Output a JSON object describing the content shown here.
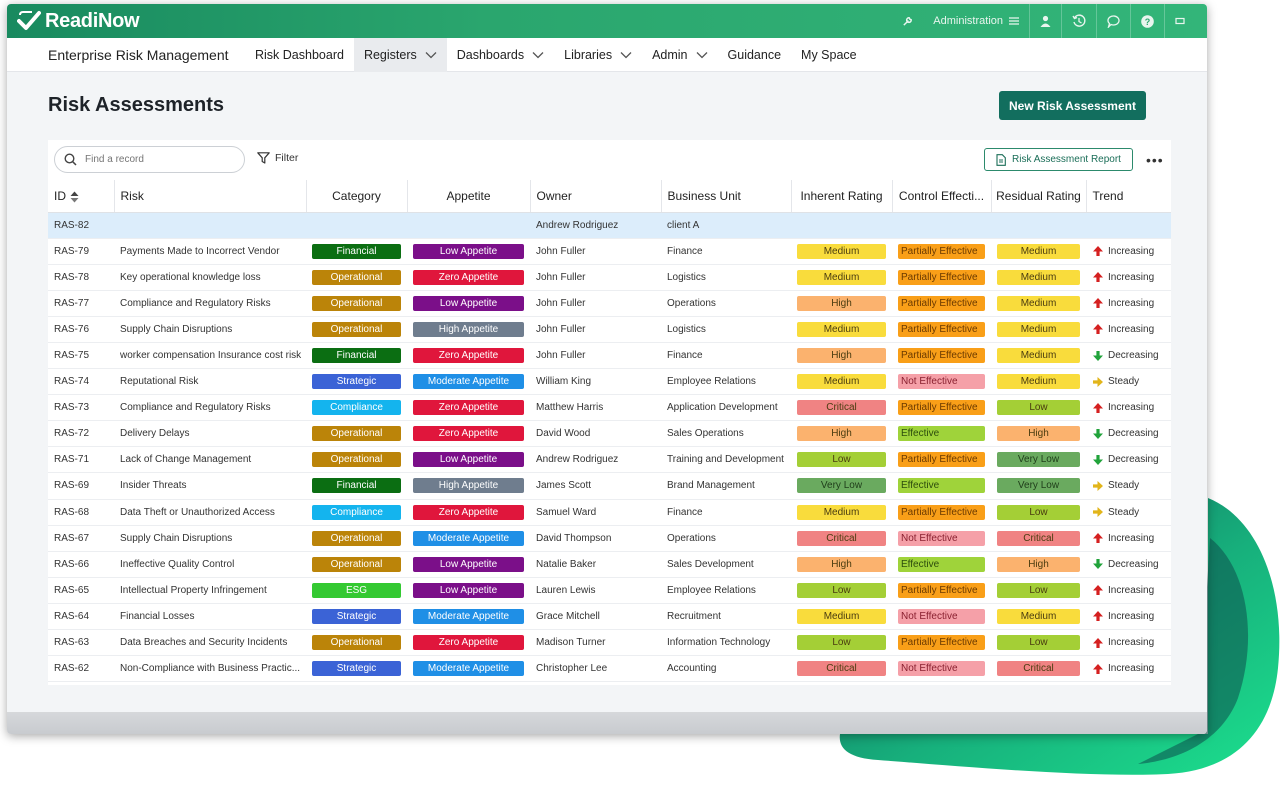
{
  "app": {
    "logo_text": "ReadiNow",
    "name": "Enterprise Risk Management"
  },
  "topbar": {
    "admin_label": "Administration"
  },
  "nav": [
    {
      "label": "Risk Dashboard",
      "dropdown": false
    },
    {
      "label": "Registers",
      "dropdown": true,
      "active": true
    },
    {
      "label": "Dashboards",
      "dropdown": true
    },
    {
      "label": "Libraries",
      "dropdown": true
    },
    {
      "label": "Admin",
      "dropdown": true
    },
    {
      "label": "Guidance",
      "dropdown": false
    },
    {
      "label": "My Space",
      "dropdown": false
    }
  ],
  "page": {
    "title": "Risk Assessments",
    "new_button": "New Risk Assessment"
  },
  "toolbar": {
    "search_placeholder": "Find a record",
    "filter_label": "Filter",
    "report_label": "Risk Assessment Report",
    "more_label": "•••"
  },
  "columns": [
    "ID",
    "Risk",
    "Category",
    "Appetite",
    "Owner",
    "Business Unit",
    "Inherent Rating",
    "Control Effecti...",
    "Residual Rating",
    "Trend"
  ],
  "colors": {
    "Financial": "#0b6e12",
    "Operational": "#bb8409",
    "Strategic": "#3b63d6",
    "Compliance": "#14b4ee",
    "ESG": "#34c932",
    "Low Appetite": "#7b0f89",
    "Zero Appetite": "#e0163c",
    "High Appetite": "#6f7d8e",
    "Moderate Appetite": "#1f8fe6",
    "Medium": "#f9dc3c",
    "High": "#fbb26e",
    "Critical": "#f08383",
    "Low": "#a4cf36",
    "Very Low": "#6aaa5f",
    "Partially Effective": "#f99f18",
    "Not Effective": "#f5a0a8",
    "Effective": "#9fd33a",
    "Increasing": "#d52020",
    "Decreasing": "#21a33b",
    "Steady": "#e2b51a"
  },
  "rows": [
    {
      "id": "RAS-82",
      "risk": "",
      "category": "",
      "appetite": "",
      "owner": "Andrew Rodriguez",
      "unit": "client A",
      "inherent": "",
      "control": "",
      "residual": "",
      "trend": "",
      "selected": true
    },
    {
      "id": "RAS-79",
      "risk": "Payments Made to Incorrect Vendor",
      "category": "Financial",
      "appetite": "Low Appetite",
      "owner": "John Fuller",
      "unit": "Finance",
      "inherent": "Medium",
      "control": "Partially Effective",
      "residual": "Medium",
      "trend": "Increasing"
    },
    {
      "id": "RAS-78",
      "risk": "Key operational knowledge loss",
      "category": "Operational",
      "appetite": "Zero Appetite",
      "owner": "John Fuller",
      "unit": "Logistics",
      "inherent": "Medium",
      "control": "Partially Effective",
      "residual": "Medium",
      "trend": "Increasing"
    },
    {
      "id": "RAS-77",
      "risk": "Compliance and Regulatory Risks",
      "category": "Operational",
      "appetite": "Low Appetite",
      "owner": "John Fuller",
      "unit": "Operations",
      "inherent": "High",
      "control": "Partially Effective",
      "residual": "Medium",
      "trend": "Increasing"
    },
    {
      "id": "RAS-76",
      "risk": "Supply Chain Disruptions",
      "category": "Operational",
      "appetite": "High Appetite",
      "owner": "John Fuller",
      "unit": "Logistics",
      "inherent": "Medium",
      "control": "Partially Effective",
      "residual": "Medium",
      "trend": "Increasing"
    },
    {
      "id": "RAS-75",
      "risk": "worker compensation Insurance cost risk",
      "category": "Financial",
      "appetite": "Zero Appetite",
      "owner": "John Fuller",
      "unit": "Finance",
      "inherent": "High",
      "control": "Partially Effective",
      "residual": "Medium",
      "trend": "Decreasing"
    },
    {
      "id": "RAS-74",
      "risk": "Reputational Risk",
      "category": "Strategic",
      "appetite": "Moderate Appetite",
      "owner": "William King",
      "unit": "Employee Relations",
      "inherent": "Medium",
      "control": "Not Effective",
      "residual": "Medium",
      "trend": "Steady"
    },
    {
      "id": "RAS-73",
      "risk": "Compliance and Regulatory Risks",
      "category": "Compliance",
      "appetite": "Zero Appetite",
      "owner": "Matthew Harris",
      "unit": "Application Development",
      "inherent": "Critical",
      "control": "Partially Effective",
      "residual": "Low",
      "trend": "Increasing"
    },
    {
      "id": "RAS-72",
      "risk": "Delivery Delays",
      "category": "Operational",
      "appetite": "Zero Appetite",
      "owner": "David Wood",
      "unit": "Sales Operations",
      "inherent": "High",
      "control": "Effective",
      "residual": "High",
      "trend": "Decreasing"
    },
    {
      "id": "RAS-71",
      "risk": "Lack of Change Management",
      "category": "Operational",
      "appetite": "Low Appetite",
      "owner": "Andrew Rodriguez",
      "unit": "Training and Development",
      "inherent": "Low",
      "control": "Partially Effective",
      "residual": "Very Low",
      "trend": "Decreasing"
    },
    {
      "id": "RAS-69",
      "risk": "Insider Threats",
      "category": "Financial",
      "appetite": "High Appetite",
      "owner": "James Scott",
      "unit": "Brand Management",
      "inherent": "Very Low",
      "control": "Effective",
      "residual": "Very Low",
      "trend": "Steady"
    },
    {
      "id": "RAS-68",
      "risk": "Data Theft or Unauthorized Access",
      "category": "Compliance",
      "appetite": "Zero Appetite",
      "owner": "Samuel Ward",
      "unit": "Finance",
      "inherent": "Medium",
      "control": "Partially Effective",
      "residual": "Low",
      "trend": "Steady"
    },
    {
      "id": "RAS-67",
      "risk": "Supply Chain Disruptions",
      "category": "Operational",
      "appetite": "Moderate Appetite",
      "owner": "David Thompson",
      "unit": "Operations",
      "inherent": "Critical",
      "control": "Not Effective",
      "residual": "Critical",
      "trend": "Increasing"
    },
    {
      "id": "RAS-66",
      "risk": "Ineffective Quality Control",
      "category": "Operational",
      "appetite": "Low Appetite",
      "owner": "Natalie Baker",
      "unit": "Sales Development",
      "inherent": "High",
      "control": "Effective",
      "residual": "High",
      "trend": "Decreasing"
    },
    {
      "id": "RAS-65",
      "risk": "Intellectual Property Infringement",
      "category": "ESG",
      "appetite": "Low Appetite",
      "owner": "Lauren Lewis",
      "unit": "Employee Relations",
      "inherent": "Low",
      "control": "Partially Effective",
      "residual": "Low",
      "trend": "Increasing"
    },
    {
      "id": "RAS-64",
      "risk": "Financial Losses",
      "category": "Strategic",
      "appetite": "Moderate Appetite",
      "owner": "Grace Mitchell",
      "unit": "Recruitment",
      "inherent": "Medium",
      "control": "Not Effective",
      "residual": "Medium",
      "trend": "Increasing"
    },
    {
      "id": "RAS-63",
      "risk": "Data Breaches and Security Incidents",
      "category": "Operational",
      "appetite": "Zero Appetite",
      "owner": "Madison Turner",
      "unit": "Information Technology",
      "inherent": "Low",
      "control": "Partially Effective",
      "residual": "Low",
      "trend": "Increasing"
    },
    {
      "id": "RAS-62",
      "risk": "Non-Compliance with Business Practic...",
      "category": "Strategic",
      "appetite": "Moderate Appetite",
      "owner": "Christopher Lee",
      "unit": "Accounting",
      "inherent": "Critical",
      "control": "Not Effective",
      "residual": "Critical",
      "trend": "Increasing"
    }
  ]
}
